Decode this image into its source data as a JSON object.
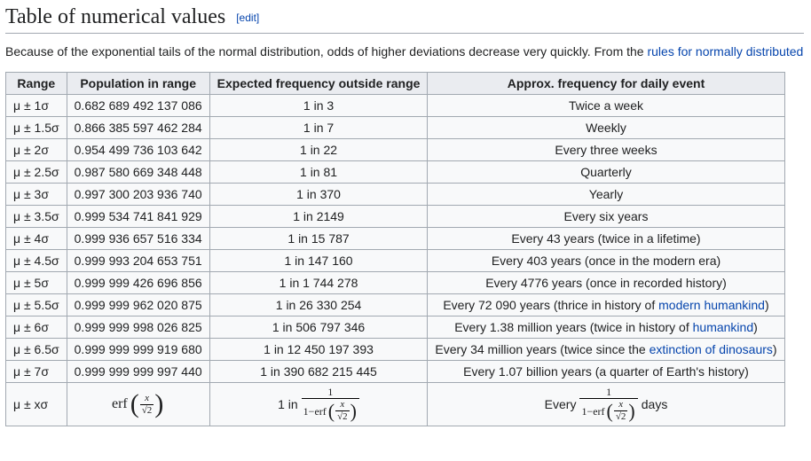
{
  "heading": "Table of numerical values",
  "edit_label": "[edit]",
  "intro_before_link": "Because of the exponential tails of the normal distribution, odds of higher deviations decrease very quickly. From the ",
  "intro_link": "rules for normally distributed",
  "headers": {
    "range": "Range",
    "population": "Population in range",
    "expected": "Expected frequency outside range",
    "approx": "Approx. frequency for daily event"
  },
  "rows": [
    {
      "range": "μ ± 1σ",
      "population": "0.682 689 492 137 086",
      "expected": "1 in 3",
      "approx_plain": "Twice a week"
    },
    {
      "range": "μ ± 1.5σ",
      "population": "0.866 385 597 462 284",
      "expected": "1 in 7",
      "approx_plain": "Weekly"
    },
    {
      "range": "μ ± 2σ",
      "population": "0.954 499 736 103 642",
      "expected": "1 in 22",
      "approx_plain": "Every three weeks"
    },
    {
      "range": "μ ± 2.5σ",
      "population": "0.987 580 669 348 448",
      "expected": "1 in 81",
      "approx_plain": "Quarterly"
    },
    {
      "range": "μ ± 3σ",
      "population": "0.997 300 203 936 740",
      "expected": "1 in 370",
      "approx_plain": "Yearly"
    },
    {
      "range": "μ ± 3.5σ",
      "population": "0.999 534 741 841 929",
      "expected": "1 in 2149",
      "approx_plain": "Every six years"
    },
    {
      "range": "μ ± 4σ",
      "population": "0.999 936 657 516 334",
      "expected": "1 in 15 787",
      "approx_plain": "Every 43 years (twice in a lifetime)"
    },
    {
      "range": "μ ± 4.5σ",
      "population": "0.999 993 204 653 751",
      "expected": "1 in 147 160",
      "approx_plain": "Every 403 years (once in the modern era)"
    },
    {
      "range": "μ ± 5σ",
      "population": "0.999 999 426 696 856",
      "expected": "1 in 1 744 278",
      "approx_plain": "Every 4776 years (once in recorded history)"
    },
    {
      "range": "μ ± 5.5σ",
      "population": "0.999 999 962 020 875",
      "expected": "1 in 26 330 254",
      "approx_pre": "Every 72 090 years (thrice in history of ",
      "approx_link": "modern humankind",
      "approx_post": ")"
    },
    {
      "range": "μ ± 6σ",
      "population": "0.999 999 998 026 825",
      "expected": "1 in 506 797 346",
      "approx_pre": "Every 1.38 million years (twice in history of ",
      "approx_link": "humankind",
      "approx_post": ")"
    },
    {
      "range": "μ ± 6.5σ",
      "population": "0.999 999 999 919 680",
      "expected": "1 in 12 450 197 393",
      "approx_pre": "Every 34 million years (twice since the ",
      "approx_link": "extinction of dinosaurs",
      "approx_post": ")"
    },
    {
      "range": "μ ± 7σ",
      "population": "0.999 999 999 997 440",
      "expected": "1 in 390 682 215 445",
      "approx_plain": "Every 1.07 billion years (a quarter of Earth's history)"
    }
  ],
  "formula_row": {
    "range": "μ ± xσ",
    "erf_label": "erf",
    "frac_num_x": "x",
    "frac_den_sqrt2": "√2",
    "one_in": "1 in",
    "one": "1",
    "one_minus_erf": "1−erf",
    "every": "Every",
    "days": "days"
  }
}
